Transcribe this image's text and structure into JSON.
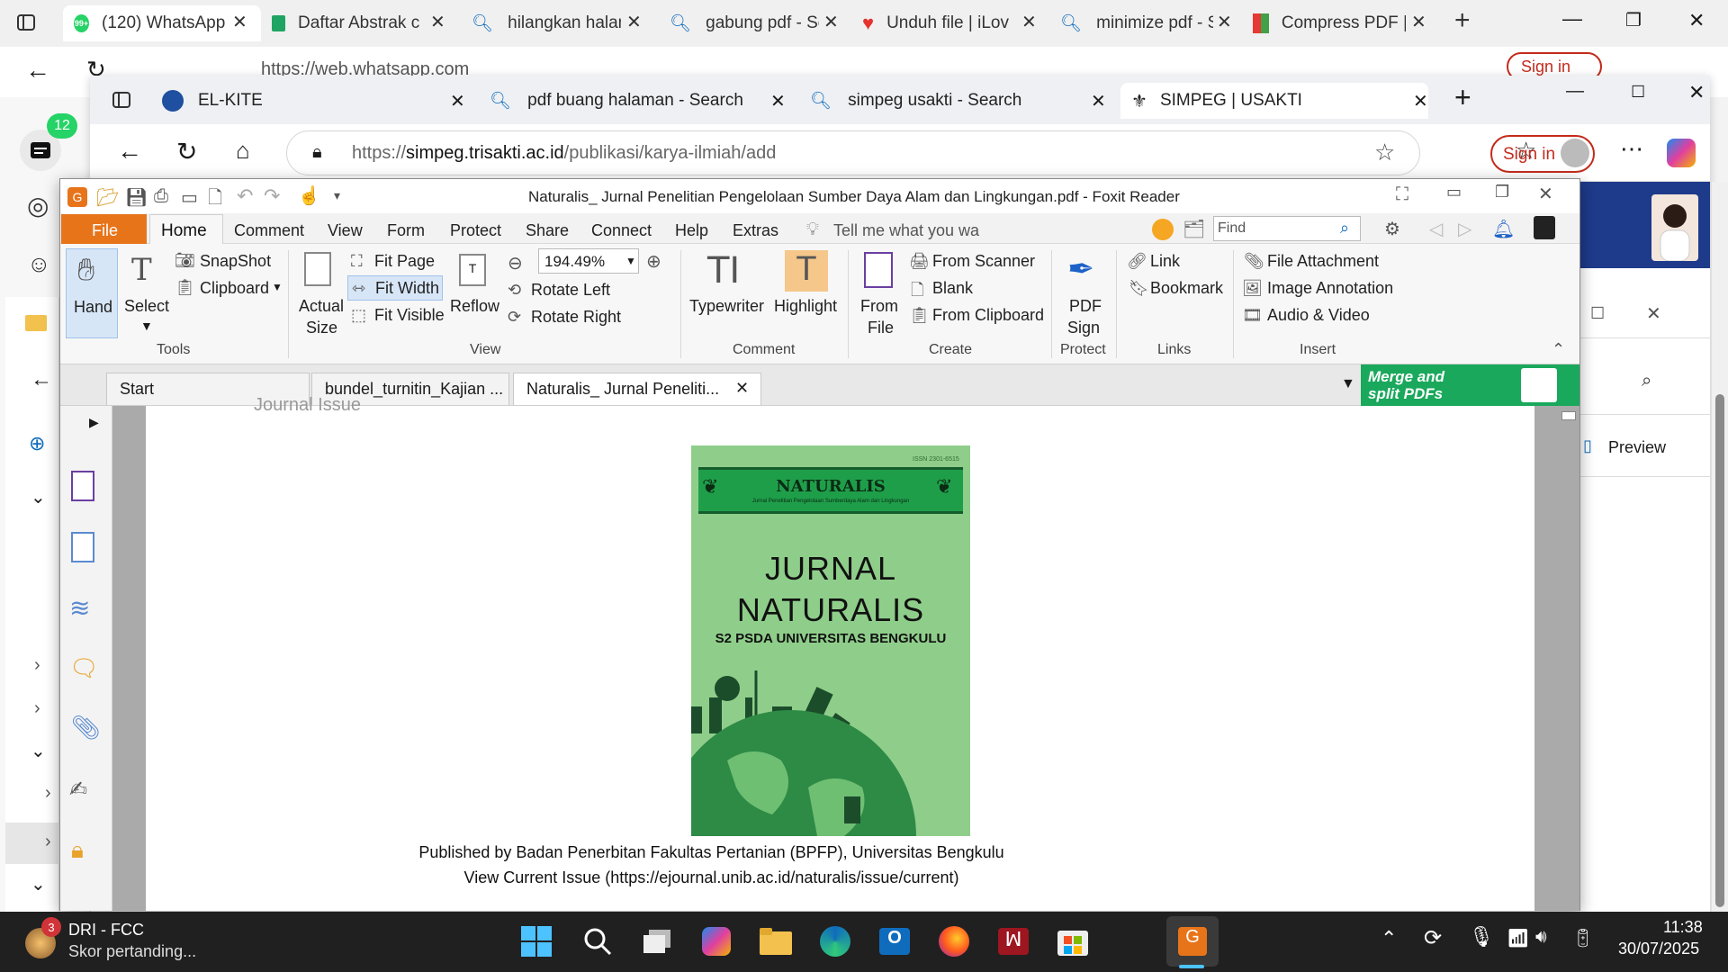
{
  "outer_browser": {
    "tabs": [
      {
        "label": "(120) WhatsApp",
        "badge": "99+"
      },
      {
        "label": "Daftar Abstrak c"
      },
      {
        "label": "hilangkan halam"
      },
      {
        "label": "gabung pdf - Se"
      },
      {
        "label": "Unduh file | iLov"
      },
      {
        "label": "minimize pdf - S"
      },
      {
        "label": "Compress PDF |"
      }
    ],
    "url": "https://web.whatsapp.com",
    "sign_in": "Sign in",
    "notif_badge": "12"
  },
  "inner_browser": {
    "tabs": [
      {
        "label": "EL-KITE"
      },
      {
        "label": "pdf buang halaman - Search"
      },
      {
        "label": "simpeg usakti - Search"
      },
      {
        "label": "SIMPEG | USAKTI"
      }
    ],
    "url_prefix": "https://",
    "url_domain": "simpeg.trisakti.ac.id",
    "url_path": "/publikasi/karya-ilmiah/add",
    "sign_in": "Sign in"
  },
  "side_panel": {
    "preview_label": "Preview"
  },
  "foxit": {
    "title": "Naturalis_ Jurnal Penelitian Pengelolaan Sumber Daya Alam dan Lingkungan.pdf - Foxit Reader",
    "menu": [
      "File",
      "Home",
      "Comment",
      "View",
      "Form",
      "Protect",
      "Share",
      "Connect",
      "Help",
      "Extras"
    ],
    "tell_me": "Tell me what you wa",
    "find_placeholder": "Find",
    "ribbon": {
      "hand": "Hand",
      "select": "Select",
      "snapshot": "SnapShot",
      "clipboard": "Clipboard",
      "actual_size_1": "Actual",
      "actual_size_2": "Size",
      "fit_page": "Fit Page",
      "fit_width": "Fit Width",
      "fit_visible": "Fit Visible",
      "reflow": "Reflow",
      "zoom": "194.49%",
      "rotate_left": "Rotate Left",
      "rotate_right": "Rotate Right",
      "typewriter": "Typewriter",
      "highlight": "Highlight",
      "from_file_1": "From",
      "from_file_2": "File",
      "from_scanner": "From Scanner",
      "blank": "Blank",
      "from_clipboard": "From Clipboard",
      "pdf_sign_1": "PDF",
      "pdf_sign_2": "Sign",
      "link": "Link",
      "bookmark": "Bookmark",
      "file_attachment": "File Attachment",
      "image_annotation": "Image Annotation",
      "audio_video": "Audio & Video"
    },
    "groups": [
      "Tools",
      "View",
      "Comment",
      "Create",
      "Protect",
      "Links",
      "Insert"
    ],
    "doc_tabs": [
      "Start",
      "bundel_turnitin_Kajian ...",
      "Naturalis_ Jurnal Peneliti..."
    ],
    "promo": {
      "line1": "Merge and",
      "line2": "split PDFs"
    }
  },
  "document": {
    "cut_text": "Journal Issue",
    "cover": {
      "issn": "ISSN 2301-6515",
      "band_title": "NATURALIS",
      "band_subtitle": "Jurnal Penelitian Pengelolaan Sumberdaya Alam dan Lingkungan",
      "title1": "JURNAL",
      "title2": "NATURALIS",
      "subtitle": "S2 PSDA UNIVERSITAS BENGKULU"
    },
    "published": "Published by Badan Penerbitan Fakultas Pertanian (BPFP), Universitas Bengkulu",
    "current_issue": "View Current Issue (https://ejournal.unib.ac.id/naturalis/issue/current)"
  },
  "taskbar": {
    "notif_count": "3",
    "app_title": "DRI - FCC",
    "app_sub": "Skor pertanding...",
    "time": "11:38",
    "date": "30/07/2025"
  },
  "colors": {
    "foxit_orange": "#e8741a",
    "cover_green": "#8fce8a",
    "band_green": "#1f9e4a",
    "promo_green": "#1aa85c",
    "edge_blue": "#0f6cbd"
  }
}
